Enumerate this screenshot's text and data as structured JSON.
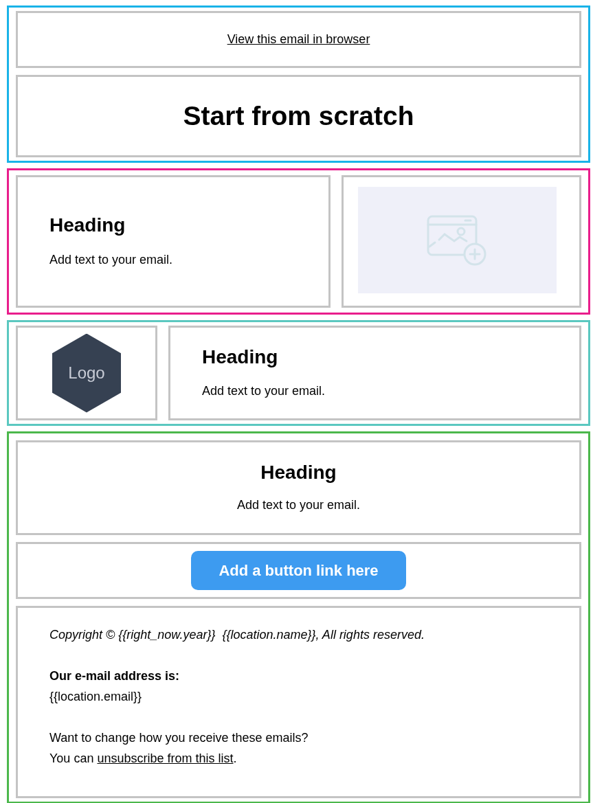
{
  "sections": [
    {
      "color": "#1ab3e8",
      "rows": [
        [
          {
            "kind": "link",
            "text": "View this email in browser"
          }
        ],
        [
          {
            "kind": "title",
            "text": "Start from scratch"
          }
        ]
      ]
    },
    {
      "color": "#e91e8c",
      "rows": [
        [
          {
            "kind": "text",
            "centered": false,
            "heading": "Heading",
            "body": "Add text to your email."
          },
          {
            "kind": "image"
          }
        ]
      ]
    },
    {
      "color": "#5bc8c0",
      "rows": [
        [
          {
            "kind": "logo",
            "text": "Logo"
          },
          {
            "kind": "text",
            "centered": false,
            "heading": "Heading",
            "body": "Add text to your email."
          }
        ]
      ]
    },
    {
      "color": "#4cb84c",
      "rows": [
        [
          {
            "kind": "text",
            "centered": true,
            "heading": "Heading",
            "body": "Add text to your email."
          }
        ],
        [
          {
            "kind": "button",
            "text": "Add a button link here"
          }
        ],
        [
          {
            "kind": "footer",
            "copyright": "Copyright © {{right_now.year}}  {{location.name}}, All rights reserved.",
            "address_label": "Our e-mail address is:",
            "address": "{{location.email}}",
            "question": "Want to change how you receive these emails?",
            "unsub_prefix": "You can ",
            "unsub_link": "unsubscribe from this list",
            "unsub_suffix": "."
          }
        ]
      ]
    }
  ]
}
